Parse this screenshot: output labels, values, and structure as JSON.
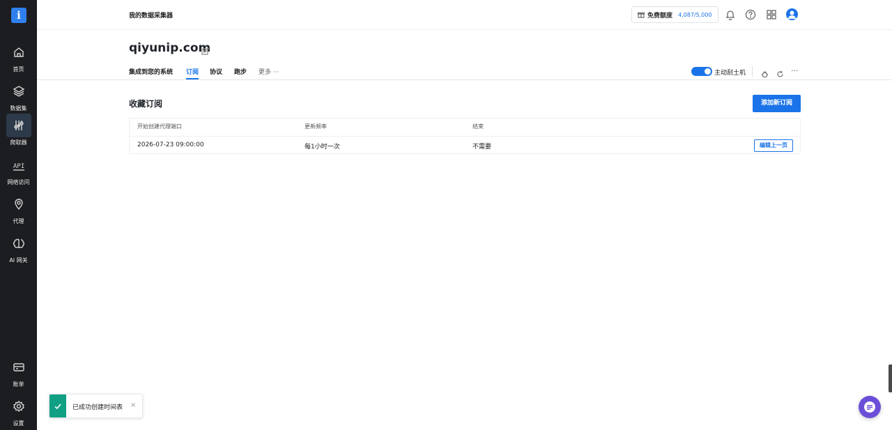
{
  "sidebar": {
    "logo": "i",
    "items": [
      {
        "label": "首页",
        "icon": "home-icon"
      },
      {
        "label": "数据集",
        "icon": "layers-icon"
      },
      {
        "label": "爬取器",
        "icon": "sliders-icon"
      },
      {
        "label": "网络访问",
        "icon": "api-icon"
      },
      {
        "label": "代理",
        "icon": "location-pin-icon"
      },
      {
        "label": "AI 网关",
        "icon": "brain-icon"
      }
    ],
    "bottom_items": [
      {
        "label": "账单",
        "icon": "card-icon"
      },
      {
        "label": "设置",
        "icon": "gear-icon"
      }
    ],
    "accent": "#2f80ed"
  },
  "header": {
    "app_title": "我的数据采集器",
    "quota_label": "免费额度",
    "quota_value": "4,087/5,000"
  },
  "page": {
    "domain_title": "qiyunip.com",
    "tabs": [
      {
        "label": "集成到您的系统"
      },
      {
        "label": "订阅"
      },
      {
        "label": "协议"
      },
      {
        "label": "跑步"
      },
      {
        "label": "更多 ···"
      }
    ],
    "active_tab_index": 1,
    "toggle_label": "主动刮土机",
    "toggle_on": true,
    "more_dots": "···"
  },
  "section": {
    "title": "收藏订阅",
    "add_button": "添加新订阅",
    "table": {
      "headers": [
        "开始创建代理端口",
        "更新频率",
        "结束"
      ],
      "rows": [
        {
          "start": "2026-07-23 09:00:00",
          "frequency": "每1小时一次",
          "end": "不需要",
          "action": "编辑上一页"
        }
      ]
    }
  },
  "toast": {
    "message": "已成功创建时间表",
    "close": "×"
  },
  "colors": {
    "primary": "#1a73e8",
    "success": "#12a085",
    "chat": "#6b4fd8"
  }
}
